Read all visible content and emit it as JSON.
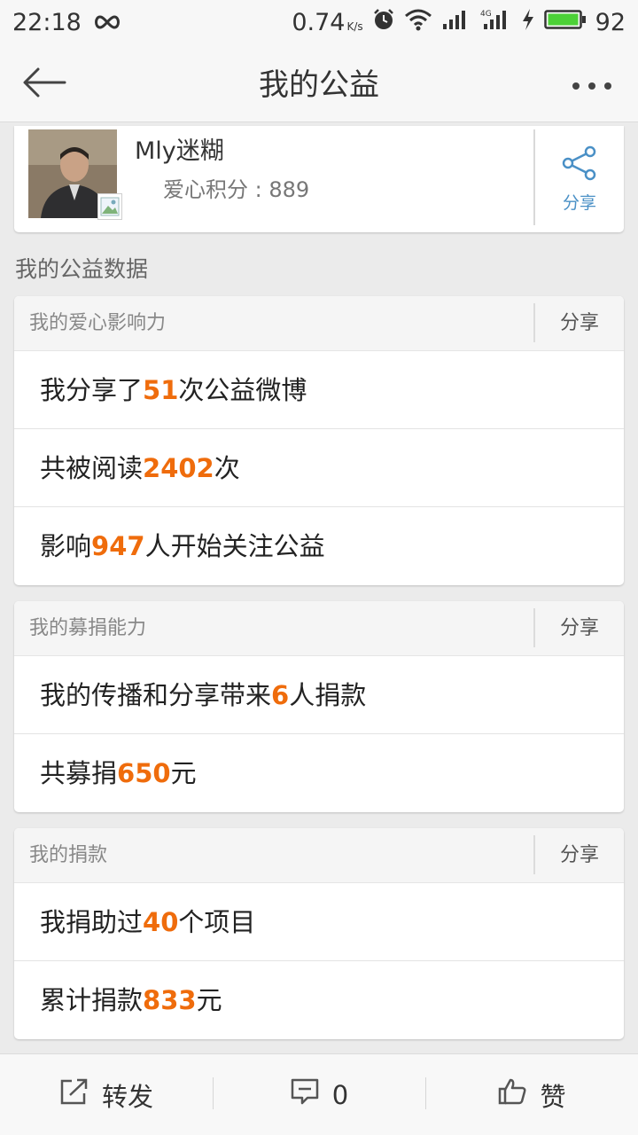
{
  "status_bar": {
    "time": "22:18",
    "speed": "0.74",
    "speed_unit": "K/s",
    "battery": "92",
    "battery_color": "#4cd137"
  },
  "nav": {
    "title": "我的公益",
    "back_icon": "arrow-left-icon",
    "more_icon": "more-dots-icon"
  },
  "profile": {
    "username": "Mly迷糊",
    "points_text": "爱心积分 : 889",
    "share_label": "分享",
    "share_icon": "share-icon"
  },
  "section_title": "我的公益数据",
  "accent_color": "#ef6c0c",
  "cards": [
    {
      "title": "我的爱心影响力",
      "share_label": "分享",
      "rows": [
        {
          "before": "我分享了",
          "num": "51",
          "after": "次公益微博"
        },
        {
          "before": "共被阅读",
          "num": "2402",
          "after": "次"
        },
        {
          "before": "影响",
          "num": "947",
          "after": "人开始关注公益"
        }
      ]
    },
    {
      "title": "我的募捐能力",
      "share_label": "分享",
      "rows": [
        {
          "before": "我的传播和分享带来",
          "num": "6",
          "after": "人捐款"
        },
        {
          "before": "共募捐",
          "num": "650",
          "after": "元"
        }
      ]
    },
    {
      "title": "我的捐款",
      "share_label": "分享",
      "rows": [
        {
          "before": "我捐助过",
          "num": "40",
          "after": "个项目"
        },
        {
          "before": "累计捐款",
          "num": "833",
          "after": "元"
        }
      ]
    }
  ],
  "bottom_bar": {
    "repost_label": "转发",
    "comment_count": "0",
    "like_label": "赞"
  }
}
